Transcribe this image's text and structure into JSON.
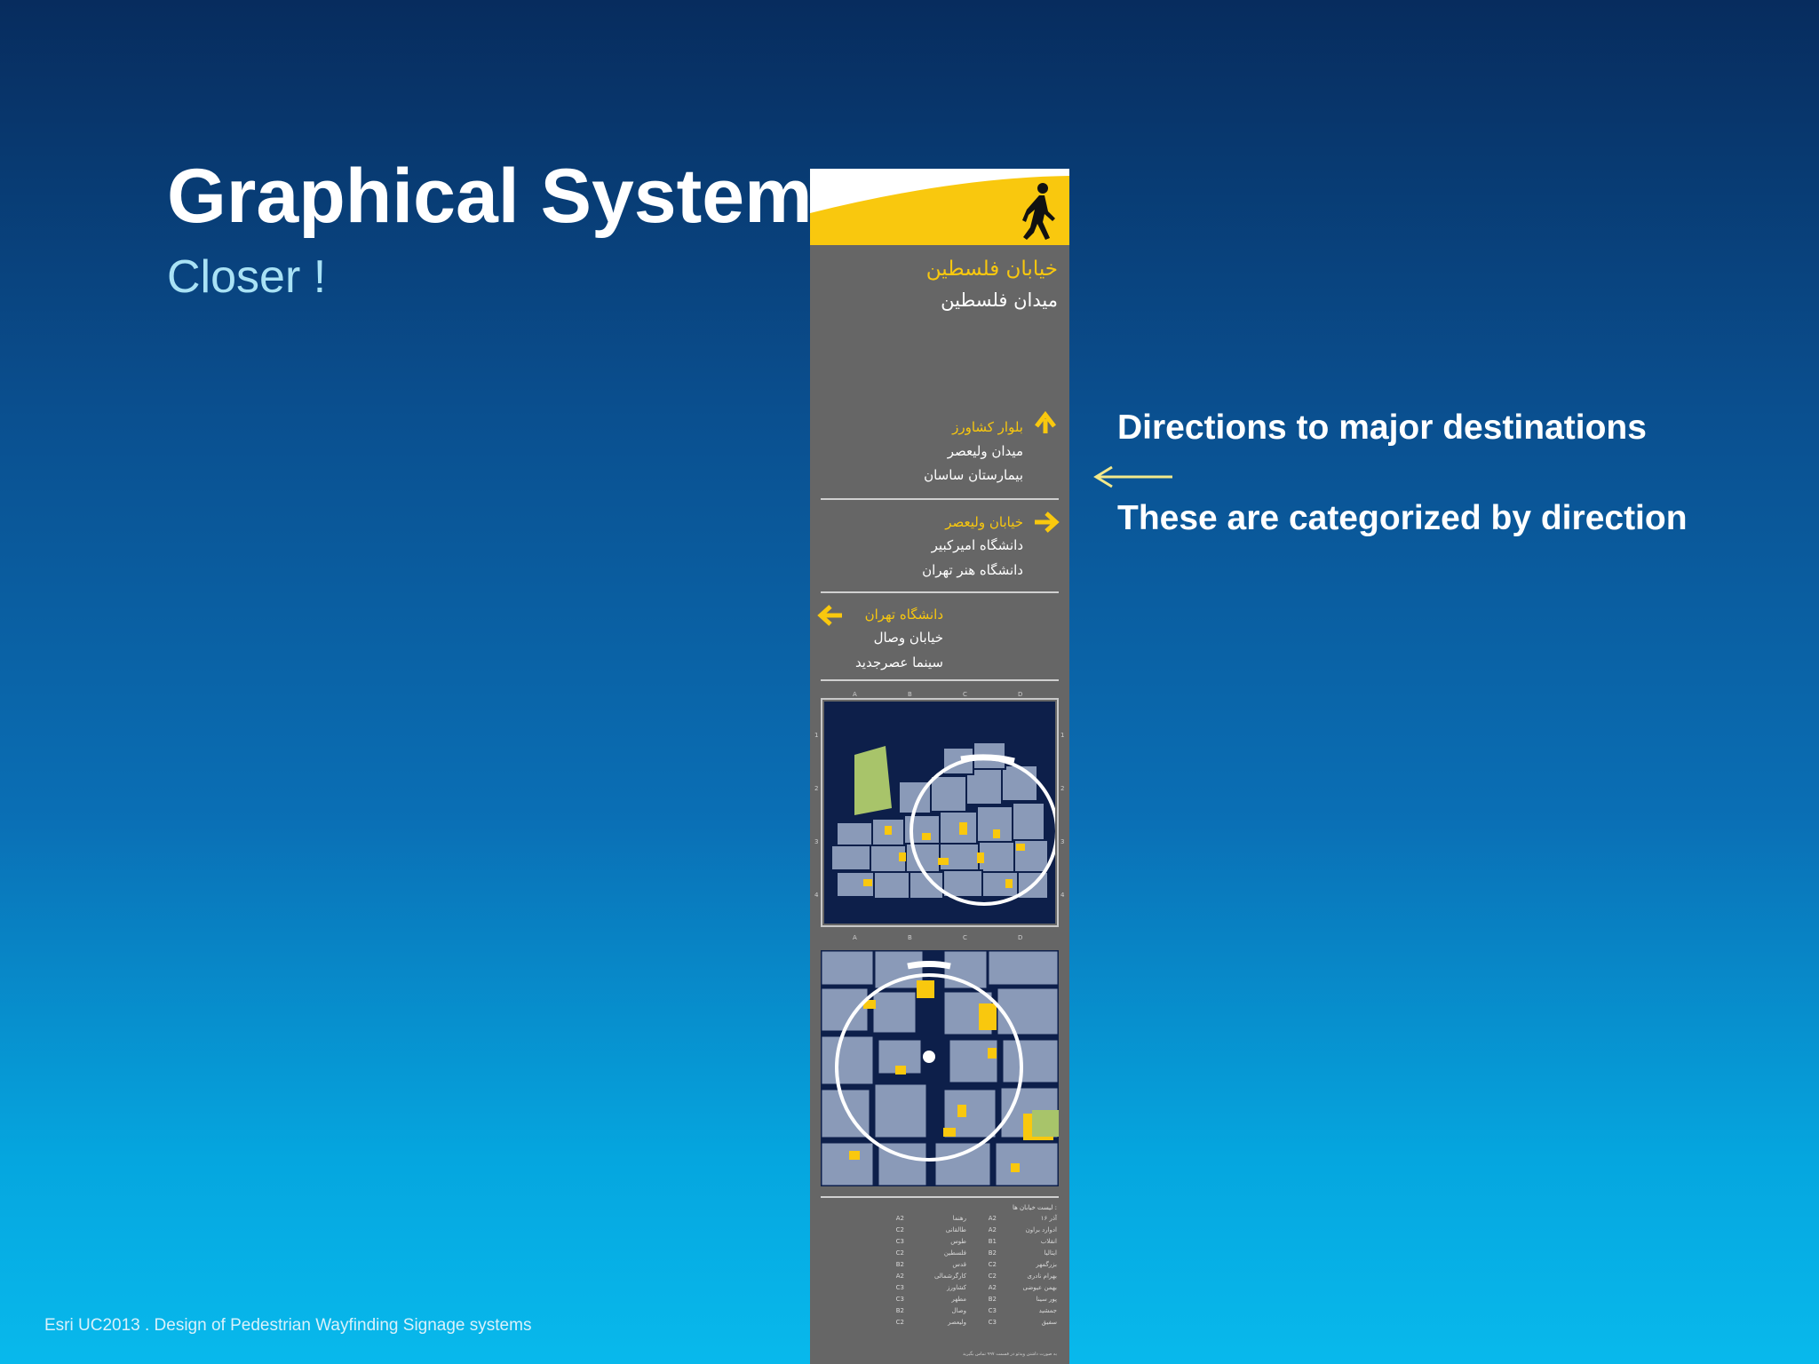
{
  "slide": {
    "title": "Graphical System",
    "subtitle": "Closer !",
    "callouts": [
      "Directions to major destinations",
      "These are categorized by direction"
    ],
    "footer": "Esri UC2013 .  Design of Pedestrian Wayfinding Signage systems"
  },
  "sign": {
    "street_name": "خیابان فلسطین",
    "square_name": "میدان فلسطین",
    "direction_groups": [
      {
        "direction": "up",
        "heading": "بلوار کشاورز",
        "items": [
          "میدان ولیعصر",
          "بیمارستان ساسان"
        ]
      },
      {
        "direction": "right",
        "heading": "خیابان ولیعصر",
        "items": [
          "دانشگاه امیرکبیر",
          "دانشگاه هنر تهران"
        ]
      },
      {
        "direction": "left",
        "heading": "دانشگاه تهران",
        "items": [
          "خیابان وصال",
          "سینما عصرجدید"
        ]
      }
    ],
    "index_title": "لیست خیابان ها :",
    "grid_columns": [
      "A",
      "B",
      "C",
      "D"
    ],
    "grid_rows": [
      "1",
      "2",
      "3",
      "4"
    ],
    "street_index": [
      {
        "name": "۱۶ آذر",
        "code": "A2",
        "name2": "رهنما",
        "code2": "A2"
      },
      {
        "name": "ادوارد براون",
        "code": "A2",
        "name2": "طالقانی",
        "code2": "C2"
      },
      {
        "name": "انقلاب",
        "code": "B1",
        "name2": "طوس",
        "code2": "C3"
      },
      {
        "name": "ایتالیا",
        "code": "B2",
        "name2": "فلسطین",
        "code2": "C2"
      },
      {
        "name": "بزرگمهر",
        "code": "C2",
        "name2": "قدس",
        "code2": "B2"
      },
      {
        "name": "بهرام نادری",
        "code": "C2",
        "name2": "کارگرشمالی",
        "code2": "A2"
      },
      {
        "name": "بهمن عیوضی",
        "code": "A2",
        "name2": "کشاورز",
        "code2": "C3"
      },
      {
        "name": "پور سینا",
        "code": "B2",
        "name2": "مطهر",
        "code2": "C3"
      },
      {
        "name": "جمشید",
        "code": "C3",
        "name2": "وصال",
        "code2": "B2"
      },
      {
        "name": "سفیق",
        "code": "C3",
        "name2": "ولیعصر",
        "code2": "C2"
      }
    ],
    "footnote": "به صورت داشتن ویدئو در قسمت ۹۹۷ تماس بگیرید"
  },
  "colors": {
    "sign_panel": "#666666",
    "sign_yellow": "#f9c80e",
    "map_dark": "#0d1f4a",
    "map_block": "#8a9ab8",
    "callout_arrow": "#f3e98a"
  },
  "icons": {
    "pedestrian": "walking-person-icon",
    "arrow_up": "arrow-up-icon",
    "arrow_right": "arrow-right-icon",
    "arrow_left": "arrow-left-icon",
    "callout_pointer": "arrow-left-icon"
  }
}
